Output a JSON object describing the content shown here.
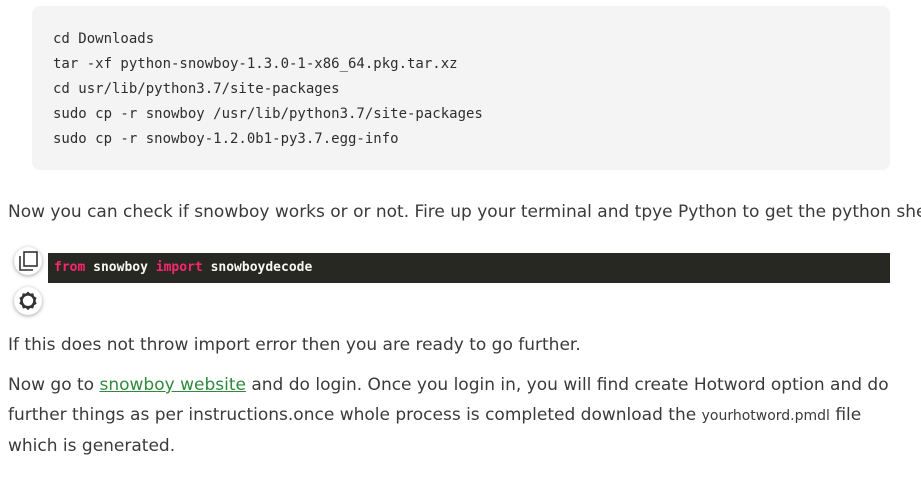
{
  "shell_block": {
    "lines": [
      "cd Downloads",
      "tar -xf python-snowboy-1.3.0-1-x86_64.pkg.tar.xz",
      "cd usr/lib/python3.7/site-packages",
      "sudo cp -r snowboy /usr/lib/python3.7/site-packages",
      "sudo cp -r snowboy-1.2.0b1-py3.7.egg-info"
    ]
  },
  "paragraph_1": "Now you can check if snowboy works or or not. Fire up your terminal and tpye Python to get the python shell.",
  "code_snippet": {
    "kw_from": "from",
    "module": "snowboy",
    "kw_import": "import",
    "name": "snowboydecode"
  },
  "toolbar": {
    "copy_icon": "copy-icon",
    "settings_icon": "gear-icon"
  },
  "paragraph_2": "If this does not throw import error then you are ready to go further.",
  "paragraph_3": {
    "before_link": "Now go to ",
    "link_text": "snowboy website",
    "after_link": " and do login. Once you login in, you will find create Hotword option and do further things as per instructions.once whole process is completed download the ",
    "filename": "yourhotword.pmdl",
    "after_filename": " file which is generated."
  },
  "colors": {
    "link": "#2f8a3d",
    "code_bg": "#272822",
    "keyword": "#f92672",
    "shell_bg": "#f4f4f5"
  }
}
